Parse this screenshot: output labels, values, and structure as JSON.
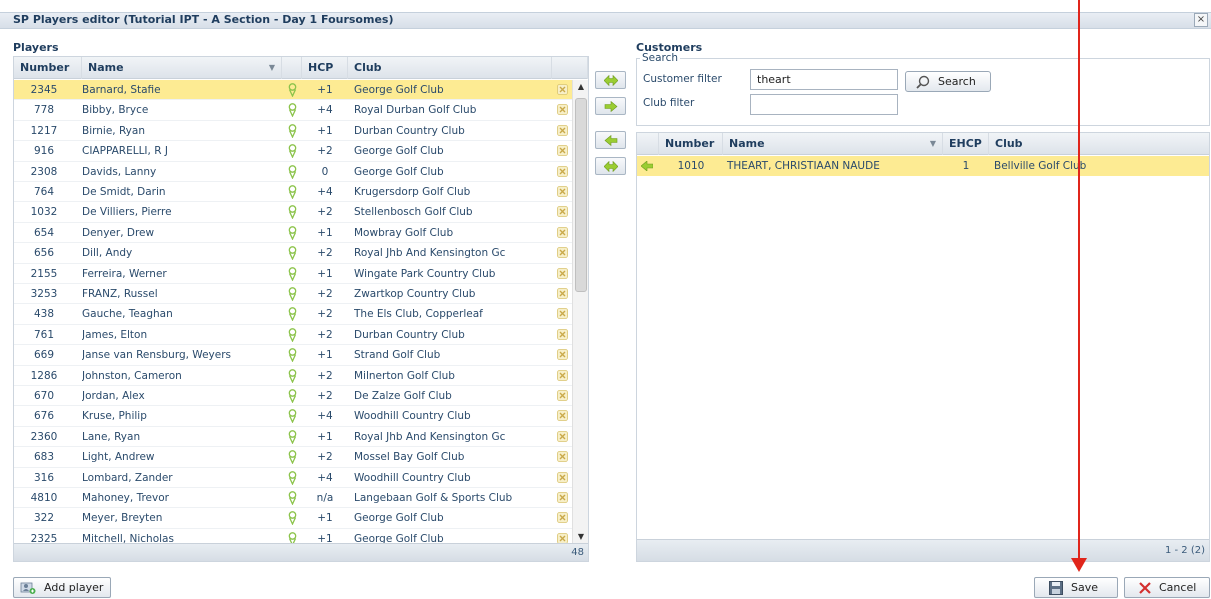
{
  "window": {
    "title": "SP Players editor (Tutorial IPT - A Section - Day 1 Foursomes)",
    "close_symbol": "×"
  },
  "players": {
    "section_title": "Players",
    "columns": {
      "number": "Number",
      "name": "Name",
      "hcp": "HCP",
      "club": "Club"
    },
    "rows": [
      {
        "number": "2345",
        "name": "Barnard, Stafie",
        "hcp": "+1",
        "club": "George Golf Club",
        "selected": true
      },
      {
        "number": "778",
        "name": "Bibby, Bryce",
        "hcp": "+4",
        "club": "Royal Durban Golf Club"
      },
      {
        "number": "1217",
        "name": "Birnie, Ryan",
        "hcp": "+1",
        "club": "Durban Country Club"
      },
      {
        "number": "916",
        "name": "CIAPPARELLI, R J",
        "hcp": "+2",
        "club": "George Golf Club"
      },
      {
        "number": "2308",
        "name": "Davids, Lanny",
        "hcp": "0",
        "club": "George Golf Club"
      },
      {
        "number": "764",
        "name": "De Smidt, Darin",
        "hcp": "+4",
        "club": "Krugersdorp Golf Club"
      },
      {
        "number": "1032",
        "name": "De Villiers, Pierre",
        "hcp": "+2",
        "club": "Stellenbosch Golf Club"
      },
      {
        "number": "654",
        "name": "Denyer, Drew",
        "hcp": "+1",
        "club": "Mowbray Golf Club"
      },
      {
        "number": "656",
        "name": "Dill, Andy",
        "hcp": "+2",
        "club": "Royal Jhb And Kensington Gc"
      },
      {
        "number": "2155",
        "name": "Ferreira, Werner",
        "hcp": "+1",
        "club": "Wingate Park Country Club"
      },
      {
        "number": "3253",
        "name": "FRANZ, Russel",
        "hcp": "+2",
        "club": "Zwartkop Country Club"
      },
      {
        "number": "438",
        "name": "Gauche, Teaghan",
        "hcp": "+2",
        "club": "The Els Club, Copperleaf"
      },
      {
        "number": "761",
        "name": "James, Elton",
        "hcp": "+2",
        "club": "Durban Country Club"
      },
      {
        "number": "669",
        "name": "Janse van Rensburg, Weyers",
        "hcp": "+1",
        "club": "Strand Golf Club"
      },
      {
        "number": "1286",
        "name": "Johnston, Cameron",
        "hcp": "+2",
        "club": "Milnerton Golf Club"
      },
      {
        "number": "670",
        "name": "Jordan, Alex",
        "hcp": "+2",
        "club": "De Zalze Golf Club"
      },
      {
        "number": "676",
        "name": "Kruse, Philip",
        "hcp": "+4",
        "club": "Woodhill Country Club"
      },
      {
        "number": "2360",
        "name": "Lane, Ryan",
        "hcp": "+1",
        "club": "Royal Jhb And Kensington Gc"
      },
      {
        "number": "683",
        "name": "Light, Andrew",
        "hcp": "+2",
        "club": "Mossel Bay Golf Club"
      },
      {
        "number": "316",
        "name": "Lombard, Zander",
        "hcp": "+4",
        "club": "Woodhill Country Club"
      },
      {
        "number": "4810",
        "name": "Mahoney, Trevor",
        "hcp": "n/a",
        "club": "Langebaan Golf & Sports Club"
      },
      {
        "number": "322",
        "name": "Meyer, Breyten",
        "hcp": "+1",
        "club": "George Golf Club"
      },
      {
        "number": "2325",
        "name": "Mitchell, Nicholas",
        "hcp": "+1",
        "club": "George Golf Club"
      }
    ],
    "total_count": "48",
    "add_button_label": "Add player"
  },
  "customers": {
    "section_title": "Customers",
    "search_legend": "Search",
    "customer_filter_label": "Customer filter",
    "customer_filter_value": "theart",
    "club_filter_label": "Club filter",
    "club_filter_value": "",
    "search_button_label": "Search",
    "columns": {
      "number": "Number",
      "name": "Name",
      "ehcp": "EHCP",
      "club": "Club"
    },
    "rows": [
      {
        "number": "1010",
        "name": "THEART, CHRISTIAAN NAUDE",
        "ehcp": "1",
        "club": "Bellville Golf Club",
        "selected": true
      }
    ],
    "paging": "1 - 2 (2)"
  },
  "actions": {
    "save_label": "Save",
    "cancel_label": "Cancel"
  },
  "colors": {
    "selection": "#fdeb93",
    "header_text": "#1f3d5e",
    "annotation": "#e0251b",
    "golfer_icon": "#8bc34a",
    "arrow_icon": "#9acd32"
  },
  "icons": {
    "row_player": "golfer-icon",
    "row_delete": "delete-icon",
    "transfer": "arrow-icon",
    "search": "magnifier-icon",
    "save": "floppy-icon",
    "cancel": "x-icon",
    "add": "add-user-icon"
  }
}
